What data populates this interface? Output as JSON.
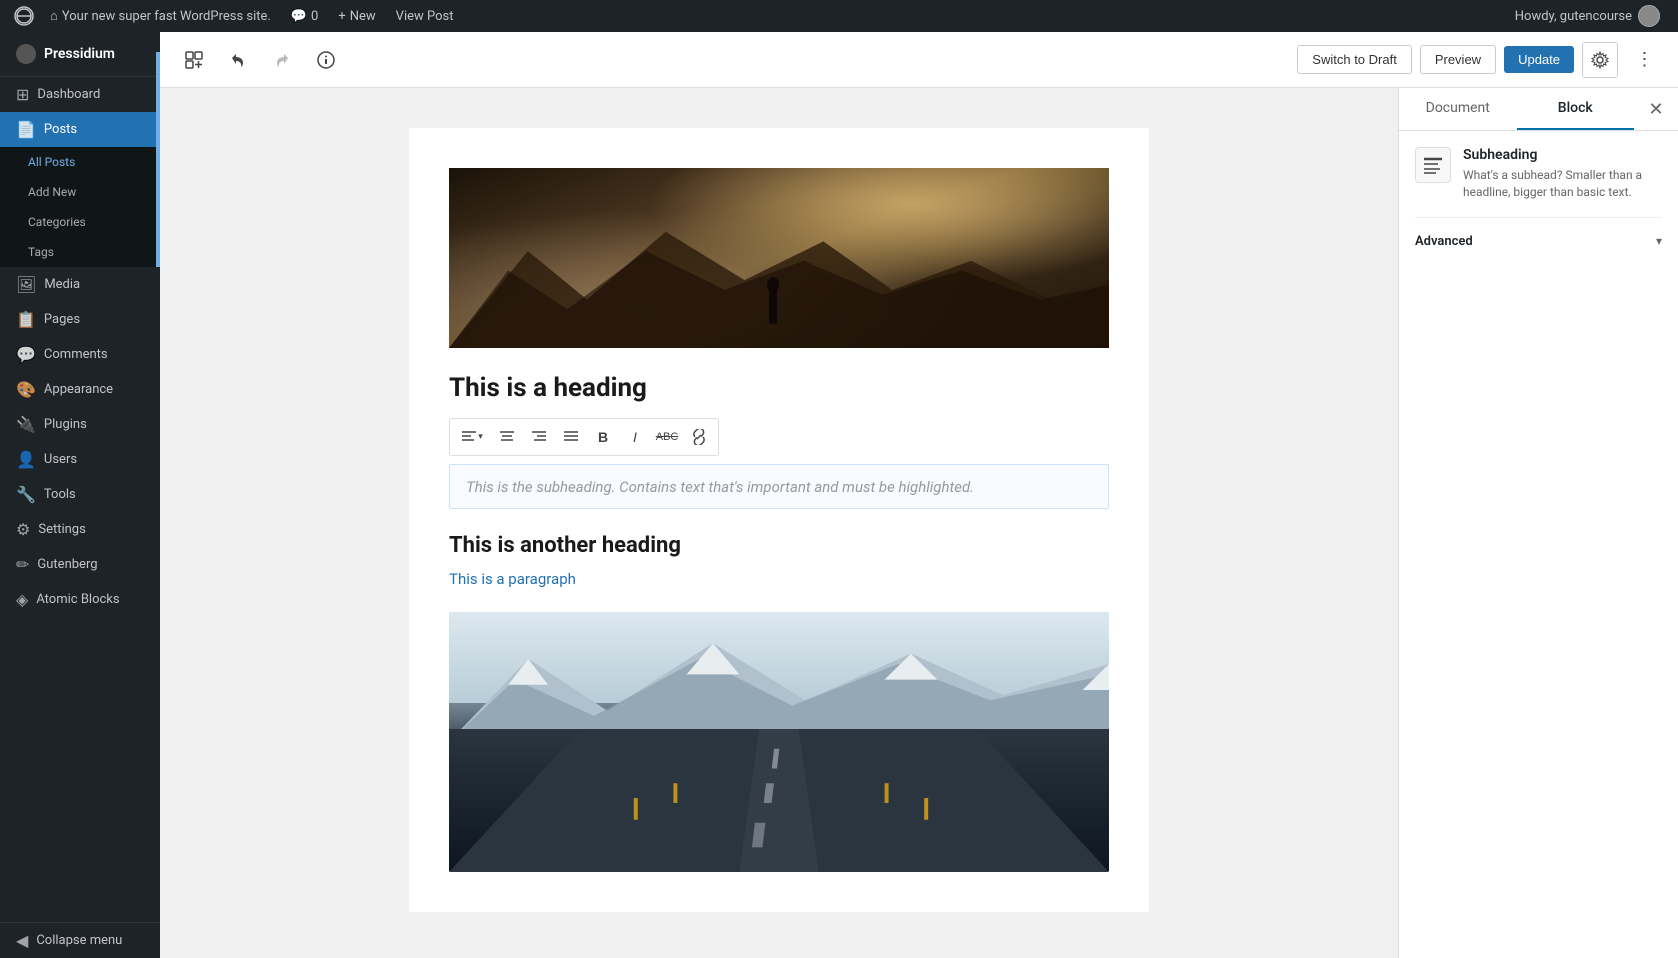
{
  "adminbar": {
    "site_name": "Your new super fast WordPress site.",
    "comment_count": "0",
    "new_label": "New",
    "view_post_label": "View Post",
    "howdy": "Howdy, gutencourse"
  },
  "sidebar": {
    "site_title": "Pressidium",
    "items": [
      {
        "id": "dashboard",
        "label": "Dashboard",
        "icon": "⊞"
      },
      {
        "id": "posts",
        "label": "Posts",
        "icon": "📄",
        "active": true
      },
      {
        "id": "all-posts",
        "label": "All Posts",
        "sub": true,
        "active_sub": true
      },
      {
        "id": "add-new",
        "label": "Add New",
        "sub": true
      },
      {
        "id": "categories",
        "label": "Categories",
        "sub": true
      },
      {
        "id": "tags",
        "label": "Tags",
        "sub": true
      },
      {
        "id": "media",
        "label": "Media",
        "icon": "🖼"
      },
      {
        "id": "pages",
        "label": "Pages",
        "icon": "📋"
      },
      {
        "id": "comments",
        "label": "Comments",
        "icon": "💬"
      },
      {
        "id": "appearance",
        "label": "Appearance",
        "icon": "🎨"
      },
      {
        "id": "plugins",
        "label": "Plugins",
        "icon": "🔌"
      },
      {
        "id": "users",
        "label": "Users",
        "icon": "👤"
      },
      {
        "id": "tools",
        "label": "Tools",
        "icon": "🔧"
      },
      {
        "id": "settings",
        "label": "Settings",
        "icon": "⚙"
      },
      {
        "id": "gutenberg",
        "label": "Gutenberg",
        "icon": "✏"
      },
      {
        "id": "atomic-blocks",
        "label": "Atomic Blocks",
        "icon": "◈"
      },
      {
        "id": "collapse",
        "label": "Collapse menu",
        "icon": "◀"
      }
    ]
  },
  "toolbar": {
    "add_block_tooltip": "Add block",
    "undo_tooltip": "Undo",
    "redo_tooltip": "Redo",
    "info_tooltip": "Information",
    "switch_draft_label": "Switch to Draft",
    "preview_label": "Preview",
    "update_label": "Update",
    "settings_tooltip": "Settings",
    "more_tooltip": "More tools & options"
  },
  "editor": {
    "heading1": "This is a heading",
    "subheading_placeholder": "This is the subheading. Contains text that's important and must be highlighted.",
    "heading2": "This is another heading",
    "paragraph": "This is a paragraph"
  },
  "right_panel": {
    "document_tab": "Document",
    "block_tab": "Block",
    "block_icon": "≡",
    "block_name": "Subheading",
    "block_description": "What's a subhead? Smaller than a headline, bigger than basic text.",
    "advanced_section": "Advanced"
  },
  "formatting_toolbar": {
    "align_left": "≡",
    "align_center": "≡",
    "align_right": "≡",
    "align_full": "≡",
    "bold": "B",
    "italic": "I",
    "strikethrough": "ABC",
    "link": "🔗",
    "dropdown_arrow": "▾"
  }
}
